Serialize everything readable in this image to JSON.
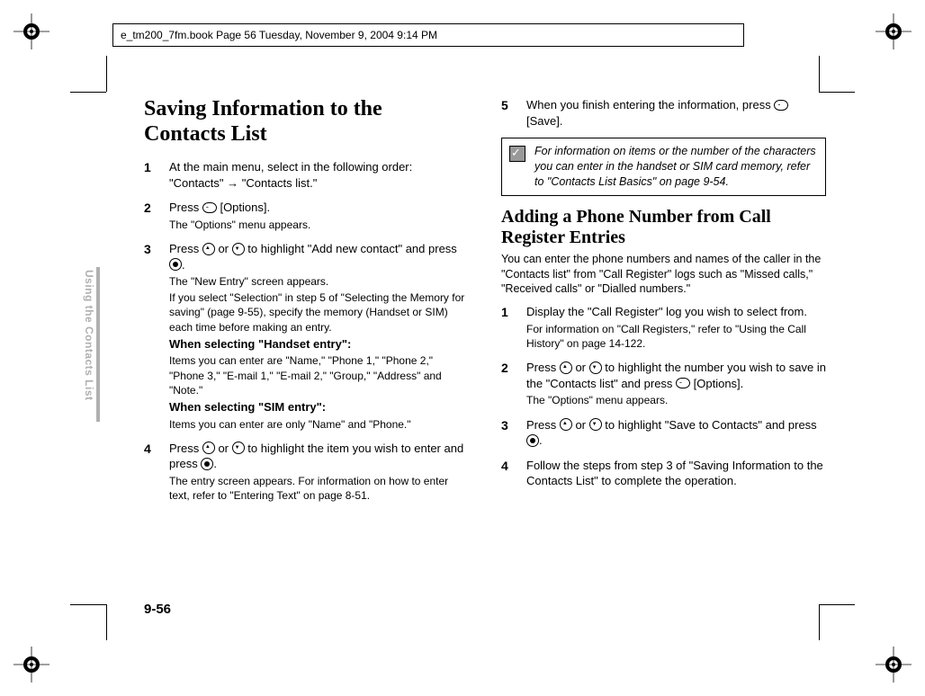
{
  "header": "e_tm200_7fm.book  Page 56  Tuesday, November 9, 2004  9:14 PM",
  "side_label": "Using the Contacts List",
  "page_number": "9-56",
  "left": {
    "title": "Saving Information to the Contacts List",
    "s1": {
      "num": "1",
      "text": "At the main menu, select in the following order: \"Contacts\" → \"Contacts list.\""
    },
    "s2": {
      "num": "2",
      "p1a": "Press ",
      "p1b": " [Options].",
      "small": "The \"Options\" menu appears."
    },
    "s3": {
      "num": "3",
      "p1a": "Press ",
      "p1b": " or ",
      "p1c": " to highlight \"Add new contact\" and press ",
      "p1d": ".",
      "l1": "The \"New Entry\" screen appears.",
      "l2": "If you select \"Selection\" in step 5 of \"Selecting the Memory for saving\" (page 9-55), specify the memory (Handset or SIM) each time before making an entry.",
      "b1": "When selecting \"Handset entry\":",
      "l3": "Items you can enter are \"Name,\" \"Phone 1,\" \"Phone 2,\" \"Phone 3,\" \"E-mail 1,\" \"E-mail 2,\" \"Group,\" \"Address\" and \"Note.\"",
      "b2": "When selecting \"SIM entry\":",
      "l4": "Items you can enter are only \"Name\" and \"Phone.\""
    },
    "s4": {
      "num": "4",
      "p1a": "Press ",
      "p1b": " or ",
      "p1c": " to highlight the item you wish to enter and press ",
      "p1d": ".",
      "small": "The entry screen appears. For information on how to enter text, refer to \"Entering Text\" on page 8-51."
    }
  },
  "right": {
    "s5": {
      "num": "5",
      "p1a": "When you finish entering the information, press ",
      "p1b": " [Save]."
    },
    "note": "For information on items or the number of the characters you can enter in the handset or SIM card memory, refer to \"Contacts List Basics\" on page 9-54.",
    "subtitle": "Adding a Phone Number from Call Register Entries",
    "intro": "You can enter the phone numbers and names of the caller in the \"Contacts list\" from \"Call Register\" logs such as \"Missed calls,\" \"Received calls\" or \"Dialled numbers.\"",
    "s1": {
      "num": "1",
      "text": "Display the \"Call Register\" log you wish to select from.",
      "small": "For information on \"Call Registers,\" refer to \"Using the Call History\" on page 14-122."
    },
    "s2": {
      "num": "2",
      "p1a": "Press ",
      "p1b": " or ",
      "p1c": " to highlight the number you wish to save in the \"Contacts list\" and press ",
      "p1d": " [Options].",
      "small": "The \"Options\" menu appears."
    },
    "s3": {
      "num": "3",
      "p1a": "Press ",
      "p1b": " or ",
      "p1c": " to highlight \"Save to Contacts\" and press ",
      "p1d": "."
    },
    "s4": {
      "num": "4",
      "text": "Follow the steps from step 3 of \"Saving Information to the Contacts List\" to complete the operation."
    }
  }
}
